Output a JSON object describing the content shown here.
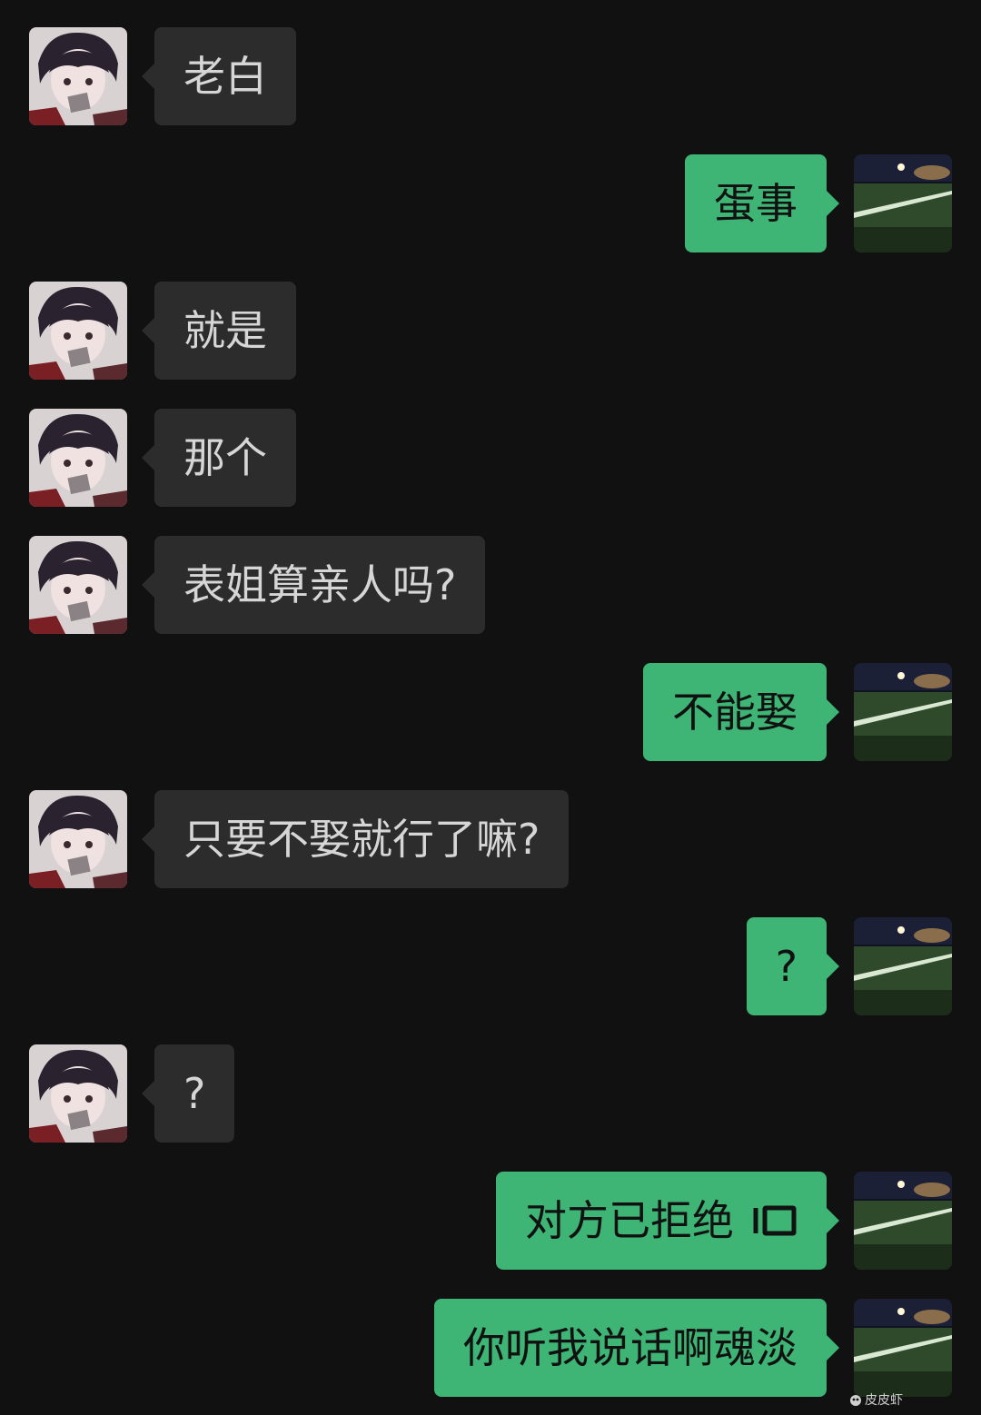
{
  "messages": [
    {
      "side": "left",
      "text": "老白"
    },
    {
      "side": "right",
      "text": "蛋事"
    },
    {
      "side": "left",
      "text": "就是"
    },
    {
      "side": "left",
      "text": "那个"
    },
    {
      "side": "left",
      "text": "表姐算亲人吗?"
    },
    {
      "side": "right",
      "text": "不能娶"
    },
    {
      "side": "left",
      "text": "只要不娶就行了嘛?"
    },
    {
      "side": "right",
      "text": "?"
    },
    {
      "side": "left",
      "text": "?"
    },
    {
      "side": "right",
      "text": "对方已拒绝",
      "icon": "voice-call-declined-icon"
    },
    {
      "side": "right",
      "text": "你听我说话啊魂淡"
    }
  ],
  "avatars": {
    "left": "anime-boy-avatar",
    "right": "night-football-field-avatar"
  },
  "watermark": {
    "text": "皮皮虾"
  },
  "colors": {
    "background": "#111111",
    "incoming_bubble": "#2c2c2c",
    "incoming_text": "#d6d6d6",
    "outgoing_bubble": "#3eb575",
    "outgoing_text": "#111111"
  }
}
